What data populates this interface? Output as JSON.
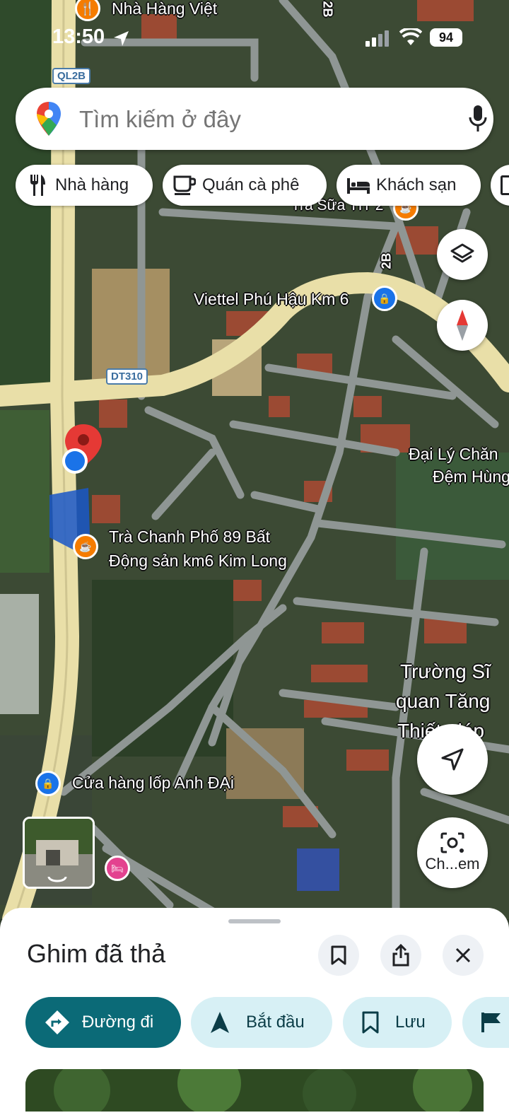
{
  "status_bar": {
    "time": "13:50",
    "battery": "94"
  },
  "search": {
    "placeholder": "Tìm kiếm ở đây"
  },
  "chips": [
    {
      "label": "Nhà hàng",
      "icon": "fork-knife-icon"
    },
    {
      "label": "Quán cà phê",
      "icon": "coffee-cup-icon"
    },
    {
      "label": "Khách sạn",
      "icon": "bed-icon"
    }
  ],
  "map": {
    "route_shields": [
      "QL2B",
      "DT310"
    ],
    "road_numbers": [
      "2B",
      "2B"
    ],
    "labels": {
      "restaurant_top": "Nhà Hàng Việt",
      "milk_tea": "Trà Sữa TIT 2",
      "viettel": "Viettel Phú Hậu Km 6",
      "dai_ly_1": "Đại Lý Chăn",
      "dai_ly_2": "Đệm Hùng",
      "tra_chanh_1": "Trà Chanh Phố 89 Bất",
      "tra_chanh_2": "Động sản km6 Kim Long",
      "truong_1": "Trường Sĩ",
      "truong_2": "quan Tăng",
      "truong_3": "Thiết giáp",
      "tire_shop": "Cửa hàng lốp Anh ĐẠi"
    },
    "camera_button_label": "Ch...em",
    "colors": {
      "road": "#e9dfa8",
      "street": "#8f9694",
      "pin": "#e53935",
      "location": "#1a73e8"
    }
  },
  "sheet": {
    "title": "Ghim đã thả",
    "actions": [
      {
        "label": "Đường đi",
        "primary": true
      },
      {
        "label": "Bắt đầu",
        "primary": false
      },
      {
        "label": "Lưu",
        "primary": false
      }
    ],
    "colors": {
      "primary": "#0b6a77",
      "secondary": "#d7f0f5"
    }
  }
}
